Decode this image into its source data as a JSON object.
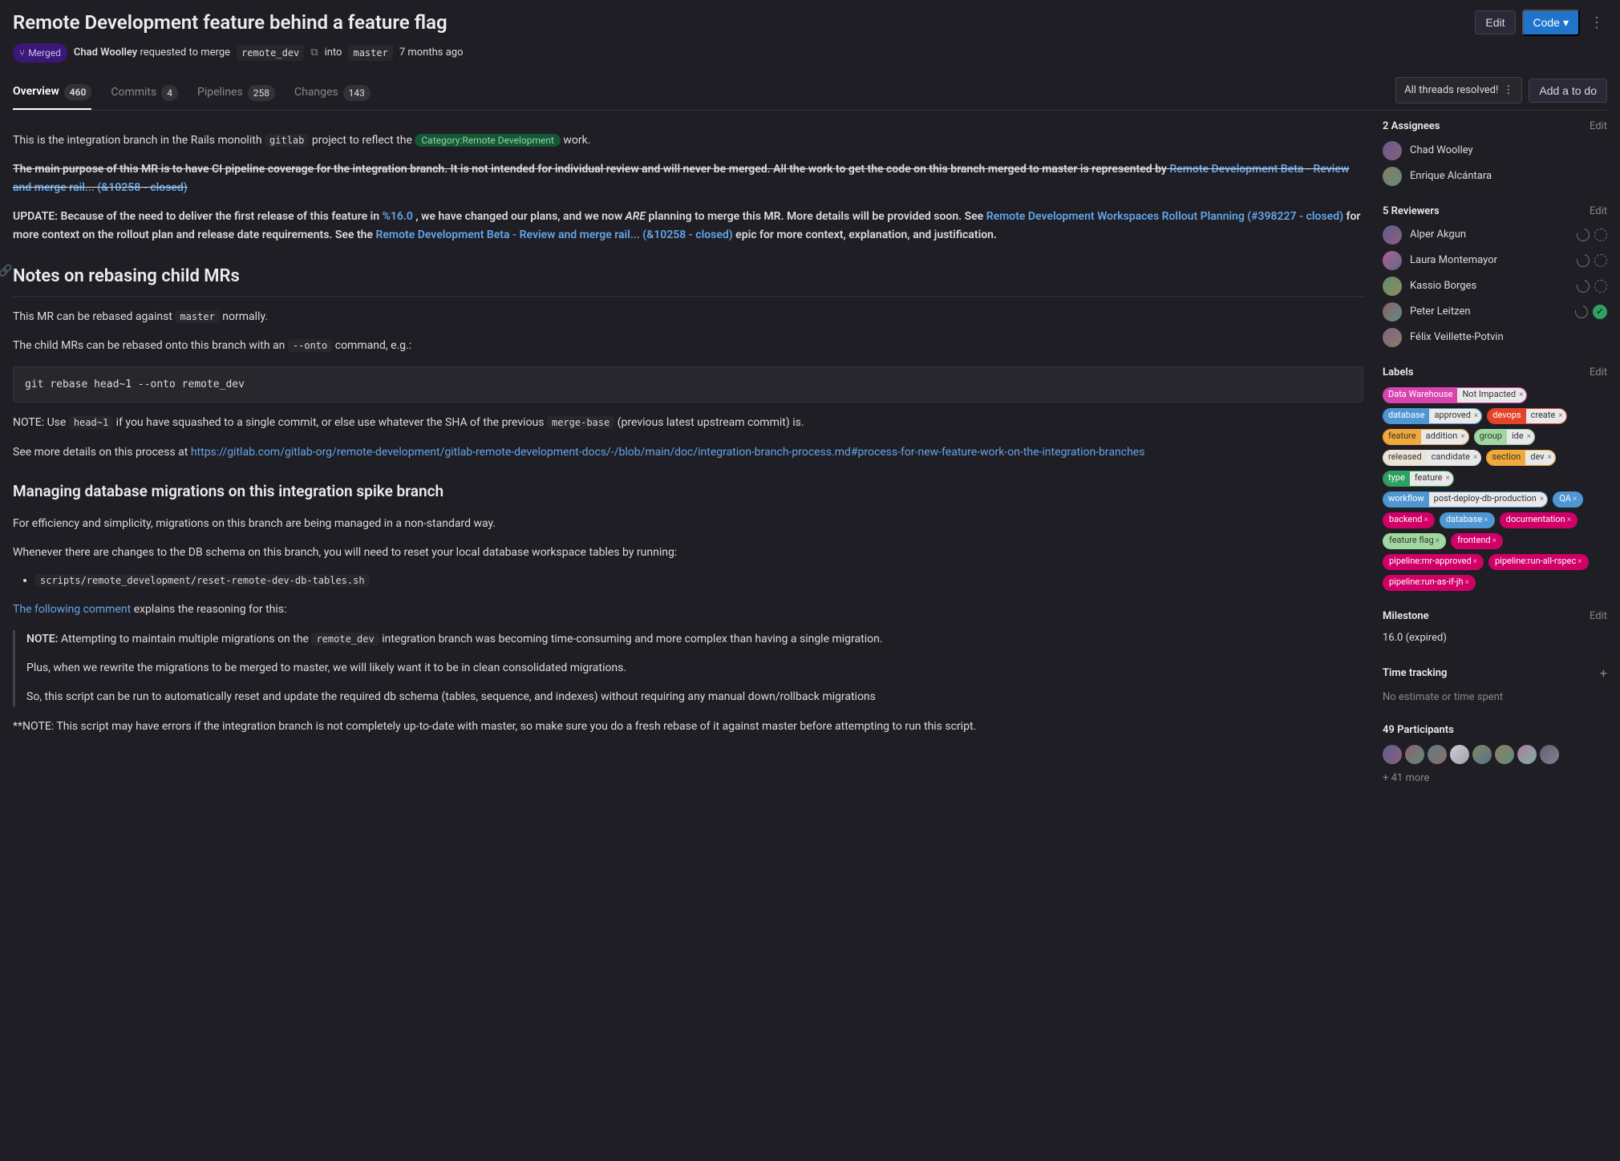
{
  "header": {
    "title": "Remote Development feature behind a feature flag",
    "edit": "Edit",
    "code": "Code",
    "status": "Merged",
    "author": "Chad Woolley",
    "requested": "requested to merge",
    "src_branch": "remote_dev",
    "into": "into",
    "target_branch": "master",
    "time": "7 months ago"
  },
  "tabs": {
    "overview": "Overview",
    "overview_count": "460",
    "commits": "Commits",
    "commits_count": "4",
    "pipelines": "Pipelines",
    "pipelines_count": "258",
    "changes": "Changes",
    "changes_count": "143"
  },
  "actions": {
    "threads": "All threads resolved!",
    "todo": "Add a to do"
  },
  "desc": {
    "p1a": "This is the integration branch in the Rails monolith",
    "p1_code": "gitlab",
    "p1b": "project to reflect the",
    "p1_cat": "Category:Remote Development",
    "p1c": "work.",
    "p2a": "The main purpose of this MR is to have CI pipeline coverage for the integration branch. It is not intended for individual review and will never be merged. All the work to get the code on this branch merged to master is represented by",
    "p2_link": "Remote Development Beta - Review and merge rail... (&10258 - closed)",
    "p3a": "UPDATE: Because of the need to deliver the first release of this feature in",
    "p3_link1": "%16.0",
    "p3b": ", we have changed our plans, and we now",
    "p3_are": "ARE",
    "p3c": "planning to merge this MR. More details will be provided soon. See",
    "p3_link2": "Remote Development Workspaces Rollout Planning (#398227 - closed)",
    "p3d": "for more context on the rollout plan and release date requirements. See the",
    "p3_link3": "Remote Development Beta - Review and merge rail... (&10258 - closed)",
    "p3e": "epic for more context, explanation, and justification.",
    "h2": "Notes on rebasing child MRs",
    "p4a": "This MR can be rebased against",
    "p4_code": "master",
    "p4b": "normally.",
    "p5a": "The child MRs can be rebased onto this branch with an",
    "p5_code": "--onto",
    "p5b": "command, e.g.:",
    "code1": "git rebase head~1 --onto remote_dev",
    "p6a": "NOTE: Use",
    "p6_code1": "head~1",
    "p6b": "if you have squashed to a single commit, or else use whatever the SHA of the previous",
    "p6_code2": "merge-base",
    "p6c": "(previous latest upstream commit) is.",
    "p7a": "See more details on this process at",
    "p7_link": "https://gitlab.com/gitlab-org/remote-development/gitlab-remote-development-docs/-/blob/main/doc/integration-branch-process.md#process-for-new-feature-work-on-the-integration-branches",
    "h3": "Managing database migrations on this integration spike branch",
    "p8": "For efficiency and simplicity, migrations on this branch are being managed in a non-standard way.",
    "p9": "Whenever there are changes to the DB schema on this branch, you will need to reset your local database workspace tables by running:",
    "li1": "scripts/remote_development/reset-remote-dev-db-tables.sh",
    "p10_link": "The following comment",
    "p10b": "explains the reasoning for this:",
    "bq1_note": "NOTE:",
    "bq1a": "Attempting to maintain multiple migrations on the",
    "bq1_code": "remote_dev",
    "bq1b": "integration branch was becoming time-consuming and more complex than having a single migration.",
    "bq2": "Plus, when we rewrite the migrations to be merged to master, we will likely want it to be in clean consolidated migrations.",
    "bq3": "So, this script can be run to automatically reset and update the required db schema (tables, sequence, and indexes) without requiring any manual down/rollback migrations",
    "p11": "**NOTE: This script may have errors if the integration branch is not completely up-to-date with master, so make sure you do a fresh rebase of it against master before attempting to run this script."
  },
  "side": {
    "assignees_title": "2 Assignees",
    "assignee1": "Chad Woolley",
    "assignee2": "Enrique Alcántara",
    "reviewers_title": "5 Reviewers",
    "rev1": "Alper Akgun",
    "rev2": "Laura Montemayor",
    "rev3": "Kassio Borges",
    "rev4": "Peter Leitzen",
    "rev5": "Félix Veillette-Potvin",
    "labels_title": "Labels",
    "milestone_title": "Milestone",
    "milestone": "16.0 (expired)",
    "time_title": "Time tracking",
    "time_text": "No estimate or time spent",
    "part_title": "49 Participants",
    "more": "+ 41 more",
    "edit": "Edit"
  },
  "labels": [
    {
      "t1": "Data Warehouse",
      "t2": "Not Impacted",
      "c": "#d945b0",
      "fg": "#fff"
    },
    {
      "t1": "database",
      "t2": "approved",
      "c": "#4f97d3",
      "fg": "#fff"
    },
    {
      "t1": "devops",
      "t2": "create",
      "c": "#e24329",
      "fg": "#fff"
    },
    {
      "t1": "feature",
      "t2": "addition",
      "c": "#f2a93b",
      "fg": "#333"
    },
    {
      "t1": "group",
      "t2": "ide",
      "c": "#a0d8a0",
      "fg": "#333"
    },
    {
      "t1": "released",
      "t2": "candidate",
      "c": "#ebe5d9",
      "fg": "#333"
    },
    {
      "t1": "section",
      "t2": "dev",
      "c": "#f2a93b",
      "fg": "#333"
    },
    {
      "t1": "type",
      "t2": "feature",
      "c": "#2da160",
      "fg": "#fff"
    },
    {
      "t1": "workflow",
      "t2": "post-deploy-db-production",
      "c": "#4f97d3",
      "fg": "#fff"
    },
    {
      "t1": "QA",
      "c": "#4f97d3",
      "fg": "#fff",
      "simple": true
    },
    {
      "t1": "backend",
      "c": "#d10069",
      "fg": "#fff",
      "simple": true
    },
    {
      "t1": "database",
      "c": "#4f97d3",
      "fg": "#fff",
      "simple": true
    },
    {
      "t1": "documentation",
      "c": "#d10069",
      "fg": "#fff",
      "simple": true
    },
    {
      "t1": "feature flag",
      "c": "#a0d8a0",
      "fg": "#333",
      "simple": true
    },
    {
      "t1": "frontend",
      "c": "#d10069",
      "fg": "#fff",
      "simple": true
    },
    {
      "t1": "pipeline:mr-approved",
      "c": "#d10069",
      "fg": "#fff",
      "simple": true
    },
    {
      "t1": "pipeline:run-all-rspec",
      "c": "#d10069",
      "fg": "#fff",
      "simple": true
    },
    {
      "t1": "pipeline:run-as-if-jh",
      "c": "#d10069",
      "fg": "#fff",
      "simple": true
    }
  ]
}
